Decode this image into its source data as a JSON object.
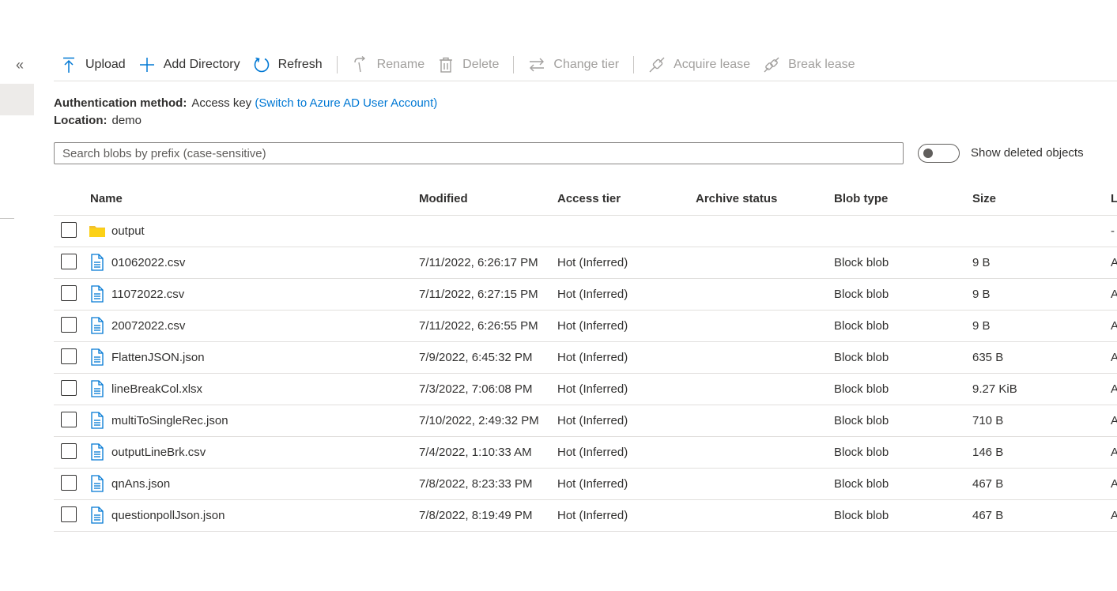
{
  "toolbar": {
    "upload": "Upload",
    "add_directory": "Add Directory",
    "refresh": "Refresh",
    "rename": "Rename",
    "delete": "Delete",
    "change_tier": "Change tier",
    "acquire_lease": "Acquire lease",
    "break_lease": "Break lease"
  },
  "rail": {
    "collapse_glyph": "«"
  },
  "info": {
    "auth_label": "Authentication method:",
    "auth_value": "Access key",
    "auth_link": "(Switch to Azure AD User Account)",
    "location_label": "Location:",
    "location_value": "demo"
  },
  "search": {
    "placeholder": "Search blobs by prefix (case-sensitive)",
    "value": ""
  },
  "deleted_toggle": {
    "label": "Show deleted objects",
    "on": false
  },
  "table": {
    "columns": {
      "name": "Name",
      "modified": "Modified",
      "access_tier": "Access tier",
      "archive_status": "Archive status",
      "blob_type": "Blob type",
      "size": "Size",
      "lease_state": "L"
    },
    "rows": [
      {
        "kind": "folder",
        "name": "output",
        "modified": "",
        "access_tier": "",
        "archive_status": "",
        "blob_type": "",
        "size": "",
        "lease_state": "-"
      },
      {
        "kind": "file",
        "name": "01062022.csv",
        "modified": "7/11/2022, 6:26:17 PM",
        "access_tier": "Hot (Inferred)",
        "archive_status": "",
        "blob_type": "Block blob",
        "size": "9 B",
        "lease_state": "A"
      },
      {
        "kind": "file",
        "name": "11072022.csv",
        "modified": "7/11/2022, 6:27:15 PM",
        "access_tier": "Hot (Inferred)",
        "archive_status": "",
        "blob_type": "Block blob",
        "size": "9 B",
        "lease_state": "A"
      },
      {
        "kind": "file",
        "name": "20072022.csv",
        "modified": "7/11/2022, 6:26:55 PM",
        "access_tier": "Hot (Inferred)",
        "archive_status": "",
        "blob_type": "Block blob",
        "size": "9 B",
        "lease_state": "A"
      },
      {
        "kind": "file",
        "name": "FlattenJSON.json",
        "modified": "7/9/2022, 6:45:32 PM",
        "access_tier": "Hot (Inferred)",
        "archive_status": "",
        "blob_type": "Block blob",
        "size": "635 B",
        "lease_state": "A"
      },
      {
        "kind": "file",
        "name": "lineBreakCol.xlsx",
        "modified": "7/3/2022, 7:06:08 PM",
        "access_tier": "Hot (Inferred)",
        "archive_status": "",
        "blob_type": "Block blob",
        "size": "9.27 KiB",
        "lease_state": "A"
      },
      {
        "kind": "file",
        "name": "multiToSingleRec.json",
        "modified": "7/10/2022, 2:49:32 PM",
        "access_tier": "Hot (Inferred)",
        "archive_status": "",
        "blob_type": "Block blob",
        "size": "710 B",
        "lease_state": "A"
      },
      {
        "kind": "file",
        "name": "outputLineBrk.csv",
        "modified": "7/4/2022, 1:10:33 AM",
        "access_tier": "Hot (Inferred)",
        "archive_status": "",
        "blob_type": "Block blob",
        "size": "146 B",
        "lease_state": "A"
      },
      {
        "kind": "file",
        "name": "qnAns.json",
        "modified": "7/8/2022, 8:23:33 PM",
        "access_tier": "Hot (Inferred)",
        "archive_status": "",
        "blob_type": "Block blob",
        "size": "467 B",
        "lease_state": "A"
      },
      {
        "kind": "file",
        "name": "questionpollJson.json",
        "modified": "7/8/2022, 8:19:49 PM",
        "access_tier": "Hot (Inferred)",
        "archive_status": "",
        "blob_type": "Block blob",
        "size": "467 B",
        "lease_state": "A"
      }
    ]
  },
  "colors": {
    "accent": "#0078d4",
    "folder": "#f2c12e",
    "file_icon": "#0078d4",
    "disabled_text": "#a19f9d",
    "divider": "#e1dfdd"
  }
}
